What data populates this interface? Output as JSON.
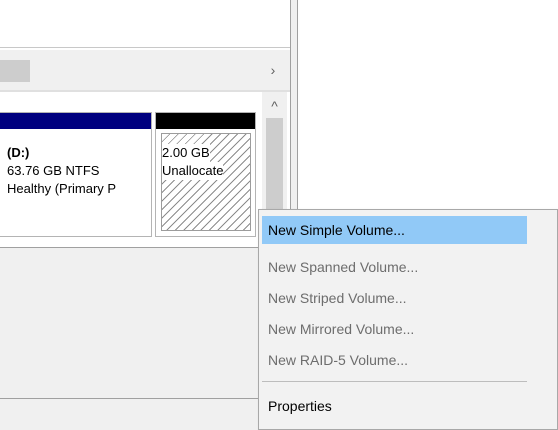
{
  "volumes": {
    "d": {
      "name": "(D:)",
      "size": "63.76 GB NTFS",
      "status": "Healthy (Primary P"
    },
    "unallocated": {
      "size": "2.00 GB",
      "status": "Unallocate"
    }
  },
  "scroll_icons": {
    "right": "›",
    "up": "^"
  },
  "context_menu": {
    "items": [
      {
        "label": "New Simple Volume...",
        "enabled": true,
        "highlighted": true
      },
      {
        "label": "New Spanned Volume...",
        "enabled": false
      },
      {
        "label": "New Striped Volume...",
        "enabled": false
      },
      {
        "label": "New Mirrored Volume...",
        "enabled": false
      },
      {
        "label": "New RAID-5 Volume...",
        "enabled": false
      },
      {
        "label": "Properties",
        "enabled": true
      }
    ]
  },
  "colors": {
    "primary_partition_bar": "#00007f",
    "unallocated_bar": "#000000",
    "menu_highlight": "#91c9f7"
  }
}
